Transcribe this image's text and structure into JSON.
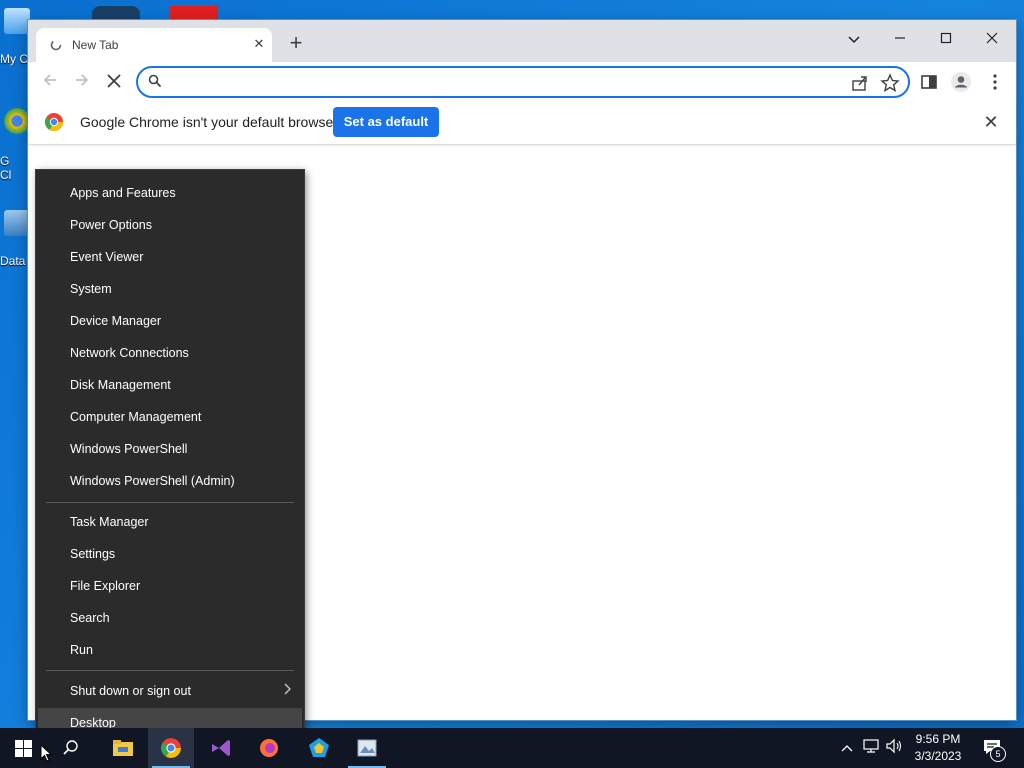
{
  "desktop": {
    "icons": [
      {
        "label": "My C"
      },
      {
        "label": "G"
      },
      {
        "label": "Cl"
      },
      {
        "label": "Data"
      }
    ]
  },
  "browser": {
    "tab": {
      "title": "New Tab"
    },
    "omnibox": {
      "value": "",
      "placeholder": ""
    },
    "infobar": {
      "message": "Google Chrome isn't your default browser",
      "button": "Set as default"
    }
  },
  "winx_menu": {
    "group1": [
      "Apps and Features",
      "Power Options",
      "Event Viewer",
      "System",
      "Device Manager",
      "Network Connections",
      "Disk Management",
      "Computer Management",
      "Windows PowerShell",
      "Windows PowerShell (Admin)"
    ],
    "group2": [
      "Task Manager",
      "Settings",
      "File Explorer",
      "Search",
      "Run"
    ],
    "group3": [
      "Shut down or sign out",
      "Desktop"
    ]
  },
  "taskbar": {
    "time": "9:56 PM",
    "date": "3/3/2023",
    "notification_count": "5",
    "apps": [
      "start-icon",
      "search-icon",
      "file-explorer-icon",
      "chrome-icon",
      "visual-studio-icon",
      "firefox-icon",
      "app-pentagon-icon",
      "image-viewer-icon"
    ]
  },
  "colors": {
    "accent": "#1a73e8",
    "menu_bg": "#2b2b2b",
    "taskbar": "#101623"
  }
}
